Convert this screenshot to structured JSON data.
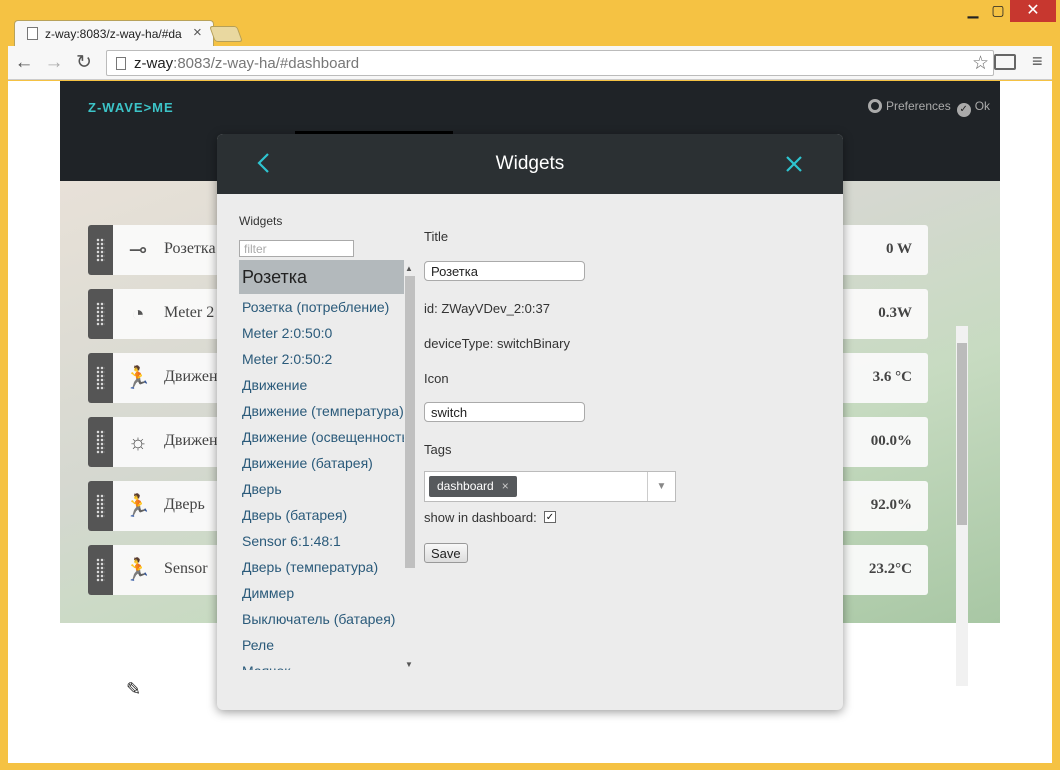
{
  "browser": {
    "tab_title": "z-way:8083/z-way-ha/#da",
    "url_host": "z-way",
    "url_rest": ":8083/z-way-ha/#dashboard",
    "min_label": "▁",
    "max_label": "▢",
    "close_label": "✕"
  },
  "app": {
    "logo": "Z-WAVE>ME",
    "preferences": "Preferences",
    "ok": "Ok",
    "widgets": [
      {
        "icon": "switch-icon",
        "name": "Розетка",
        "value": "0 W"
      },
      {
        "icon": "meter-icon",
        "name": "Meter 2",
        "value": "0.3W"
      },
      {
        "icon": "motion-icon",
        "name": "Движен",
        "value": "3.6 °C"
      },
      {
        "icon": "light-icon",
        "name": "Движен",
        "value": "00.0%"
      },
      {
        "icon": "motion-icon",
        "name": "Дверь",
        "value": "92.0%"
      },
      {
        "icon": "motion-icon",
        "name": "Sensor",
        "value": "23.2°C"
      }
    ]
  },
  "modal": {
    "title": "Widgets",
    "list_label": "Widgets",
    "filter_placeholder": "filter",
    "items": [
      "Розетка",
      "Розетка (потребление)",
      "Meter 2:0:50:0",
      "Meter 2:0:50:2",
      "Движение",
      "Движение (температура)",
      "Движение (освещенность)",
      "Движение (батарея)",
      "Дверь",
      "Дверь (батарея)",
      "Sensor 6:1:48:1",
      "Дверь (температура)",
      "Диммер",
      "Выключатель (батарея)",
      "Реле",
      "Маячок"
    ],
    "selected_index": 0,
    "form": {
      "title_label": "Title",
      "title_value": "Розетка",
      "id_text": "id: ZWayVDev_2:0:37",
      "device_type_text": "deviceType: switchBinary",
      "icon_label": "Icon",
      "icon_value": "switch",
      "tags_label": "Tags",
      "tag": "dashboard",
      "show_label": "show in dashboard:",
      "show_checked": true,
      "save_label": "Save"
    }
  }
}
